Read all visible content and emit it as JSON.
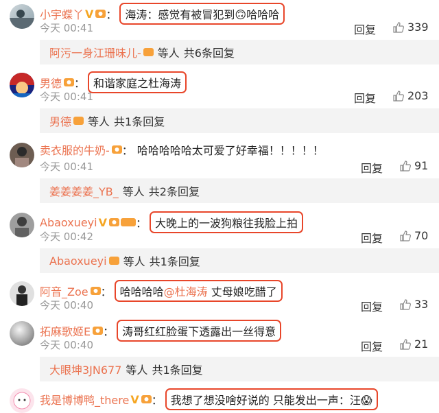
{
  "comments": [
    {
      "name": "小宇蝶丫",
      "content": "海涛：感觉有被冒犯到🙃哈哈哈",
      "time": "今天 00:41",
      "reply": "回复",
      "likes": "339",
      "vip": true
    },
    {
      "name": "男德",
      "content": "和谐家庭之杜海涛",
      "time": "今天 00:41",
      "reply": "回复",
      "likes": "203",
      "vip": false
    },
    {
      "name": "卖衣服的牛奶-",
      "content": "哈哈哈哈哈太可爱了好幸福！！！！！",
      "time": "今天 00:41",
      "reply": "回复",
      "likes": "91",
      "vip": false
    },
    {
      "name": "Abaoxueyi",
      "content": "大晚上的一波狗粮往我脸上拍",
      "time": "今天 00:42",
      "reply": "回复",
      "likes": "70",
      "vip": true
    },
    {
      "name": "阿音_Zoe",
      "content": "哈哈哈哈",
      "mention": "@杜海涛",
      "content_tail": " 丈母娘吃醋了",
      "time": "今天 00:40",
      "reply": "回复",
      "likes": "33",
      "vip": false
    },
    {
      "name": "拓麻歌姬E",
      "content": "涛哥红红脸蛋下透露出一丝得意",
      "time": "今天 00:40",
      "reply": "回复",
      "likes": "21",
      "vip": false
    },
    {
      "name": "我是博博鸭_there",
      "content": "我想了想没啥好说的 只能发出一声：汪😱",
      "time": "",
      "reply": "",
      "likes": "",
      "vip": true
    }
  ],
  "subreplies": [
    {
      "user": "阿污一身江珊味儿-",
      "suffix": "等人",
      "count": "共6条回复"
    },
    {
      "user": "男德",
      "suffix": "等人",
      "count": "共1条回复"
    },
    {
      "user": "姜姜姜姜_YB_",
      "suffix": "等人",
      "count": "共2条回复"
    },
    {
      "user": "Abaoxueyi",
      "suffix": "等人",
      "count": "共1条回复"
    },
    {
      "user": "大眼坤3JN677",
      "suffix": "等人",
      "count": "共1条回复"
    }
  ],
  "colors": {
    "username": "#eb7350",
    "highlight_border": "#e8462a",
    "muted": "#999999",
    "subbar_bg": "#f3f3f3"
  },
  "icons": [
    "avatar",
    "vip-v-icon",
    "fan-badge-icon",
    "thumbs-up-icon",
    "emoji-icon"
  ]
}
